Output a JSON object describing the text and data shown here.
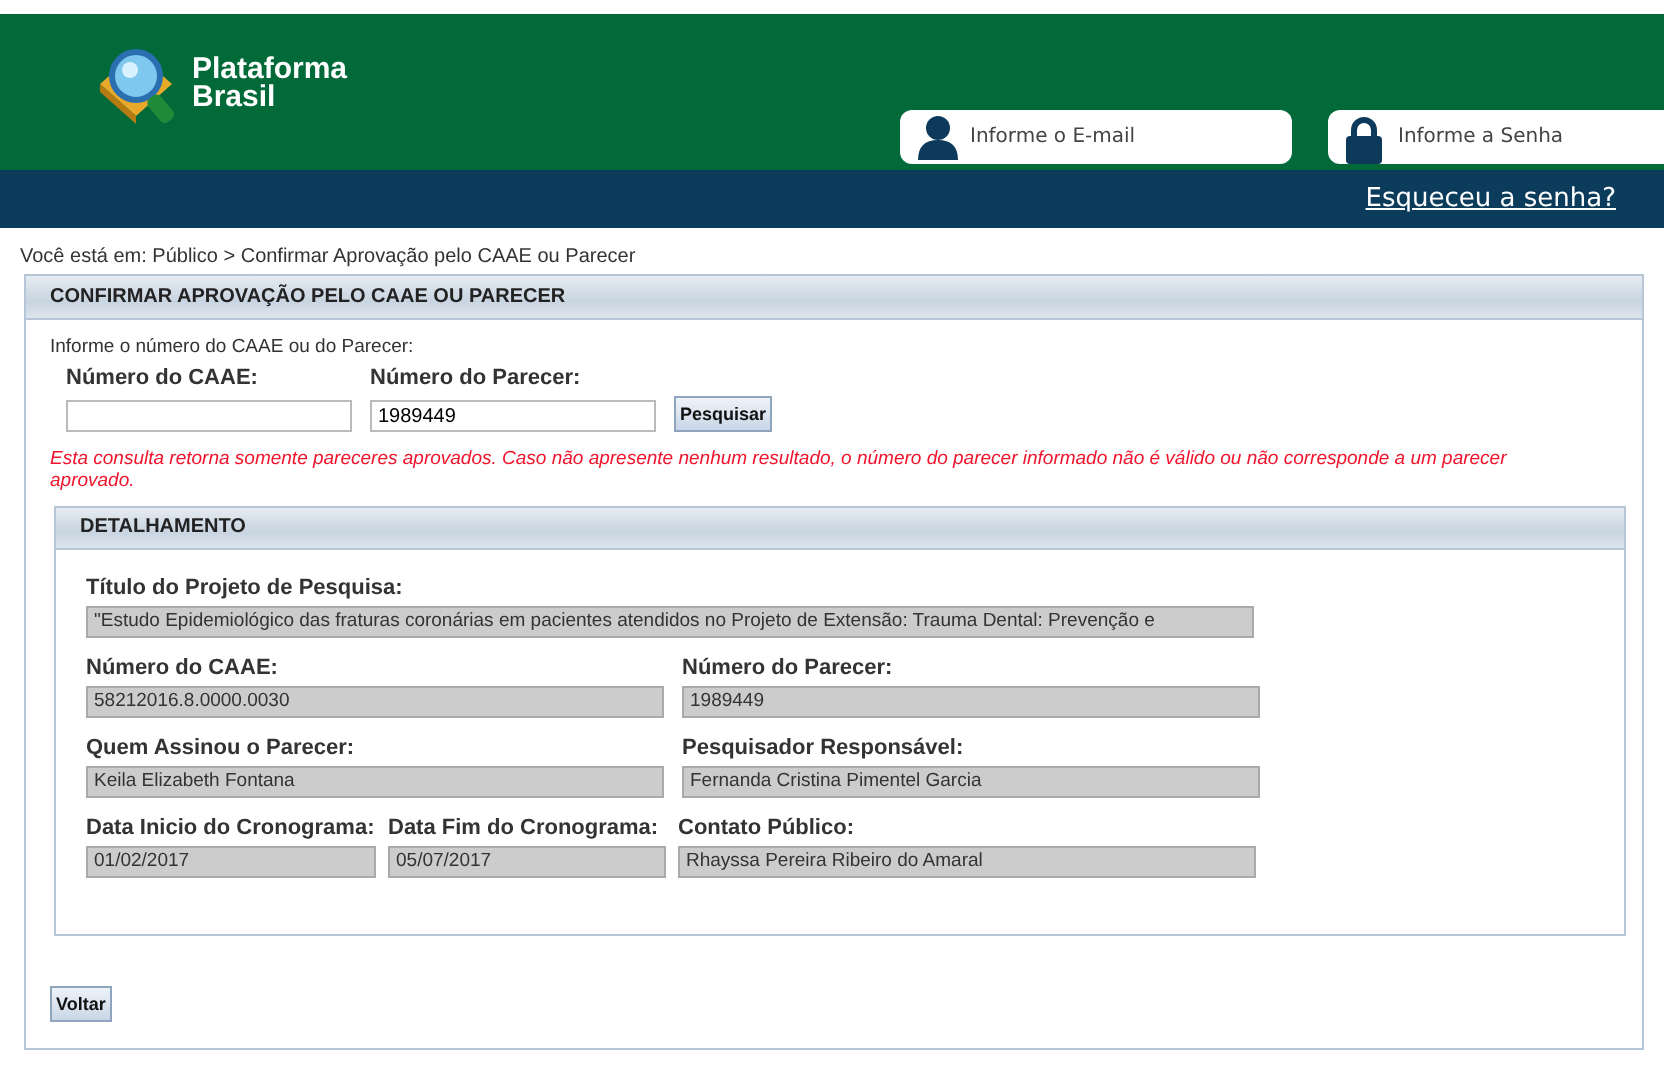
{
  "header": {
    "logo": {
      "line_1": "Plataforma",
      "line_2": "Brasil"
    },
    "email_field": {
      "placeholder": "Informe o E-mail"
    },
    "password_field": {
      "placeholder": "Informe a Senha"
    },
    "forgot_link": "Esqueceu a senha?"
  },
  "breadcrumb": "Você está em: Público > Confirmar Aprovação pelo CAAE ou Parecer",
  "panel": {
    "title": "CONFIRMAR APROVAÇÃO PELO CAAE OU PARECER",
    "instruction": "Informe o número do CAAE ou do Parecer:",
    "search_fields": [
      {
        "label": "Número do CAAE:"
      },
      {
        "label": "Número do Parecer:",
        "value": "1989449"
      }
    ],
    "search_button": "Pesquisar",
    "notice": "Esta consulta retorna somente pareceres aprovados. Caso não apresente nenhum resultado, o número do parecer informado não é válido ou não corresponde a um parecer aprovado.",
    "detail": {
      "title": "DETALHAMENTO",
      "rows": [
        [
          {
            "label": "Título do Projeto de Pesquisa:",
            "value": "\"Estudo Epidemiológico das fraturas coronárias em pacientes atendidos no Projeto de Extensão: Trauma Dental: Prevenção e"
          }
        ],
        [
          {
            "label": "Número do CAAE:",
            "value": "58212016.8.0000.0030"
          },
          {
            "label": "Número do Parecer:",
            "value": "1989449"
          }
        ],
        [
          {
            "label": "Quem Assinou o Parecer:",
            "value": "Keila Elizabeth Fontana"
          },
          {
            "label": "Pesquisador Responsável:",
            "value": "Fernanda Cristina Pimentel Garcia"
          }
        ],
        [
          {
            "label": "Data Inicio do Cronograma:",
            "value": "01/02/2017"
          },
          {
            "label": "Data Fim do Cronograma:",
            "value": "05/07/2017"
          },
          {
            "label": "Contato Público:",
            "value": "Rhayssa Pereira Ribeiro do Amaral"
          }
        ]
      ]
    },
    "back_button": "Voltar"
  }
}
